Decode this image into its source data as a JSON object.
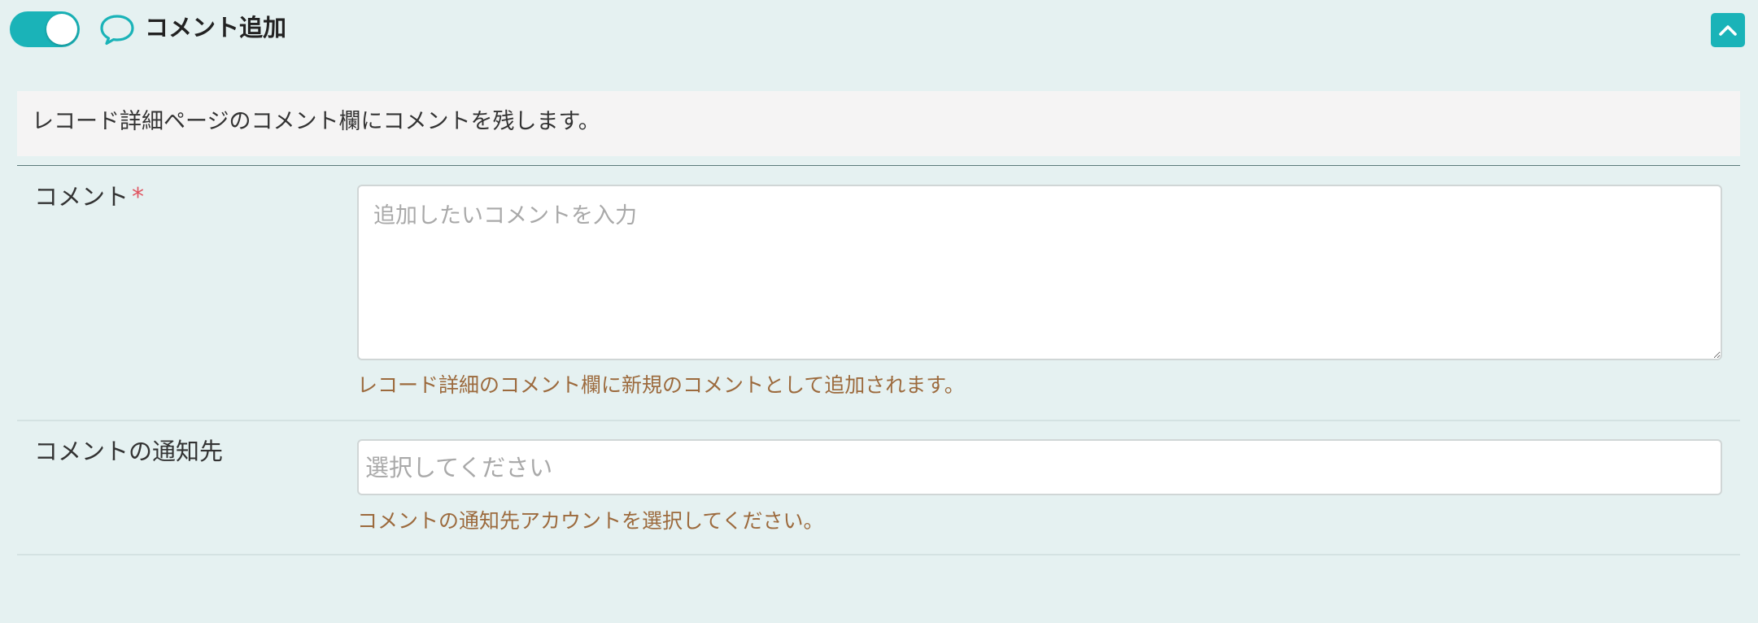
{
  "header": {
    "title": "コメント追加",
    "toggle_state": "on",
    "toggle_icon": "toggle-switch",
    "comment_icon": "speech-bubble-icon",
    "collapse_icon": "chevron-up-icon"
  },
  "description": "レコード詳細ページのコメント欄にコメントを残します。",
  "fields": {
    "comment": {
      "label": "コメント",
      "required_mark": "*",
      "placeholder": "追加したいコメントを入力",
      "value": "",
      "help": "レコード詳細のコメント欄に新規のコメントとして追加されます。"
    },
    "notify": {
      "label": "コメントの通知先",
      "placeholder": "選択してください",
      "help": "コメントの通知先アカウントを選択してください。"
    }
  },
  "colors": {
    "accent": "#1ab3b8",
    "background": "#e5f1f1",
    "help_text": "#9c6a3d",
    "required": "#e05561"
  }
}
